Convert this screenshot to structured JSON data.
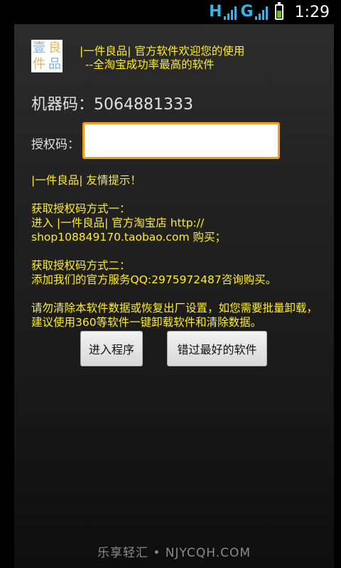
{
  "status_bar": {
    "network1": "H",
    "network2": "G",
    "time": "1:29",
    "colors": {
      "signal": "#33b5e5",
      "battery_fill": "#66bb22"
    }
  },
  "app": {
    "logo": {
      "chars": [
        "壹",
        "良",
        "件",
        "品"
      ]
    },
    "header_line1": "|一件良品|  官方软件欢迎您的使用",
    "header_line2": "--全淘宝成功率最高的软件",
    "machine_code_label": "机器码：",
    "machine_code_value": "5064881333",
    "auth_label": "授权码：",
    "auth_input_value": "",
    "tips": {
      "title": "|一件良品|  友情提示！",
      "method1_title": "获取授权码方式一：",
      "method1_line1": "进入 |一件良品|  官方淘宝店   http://",
      "method1_line2": "shop108849170.taobao.com  购买；",
      "method2_title": "获取授权码方式二：",
      "method2_line1": "添加我们的官方服务QQ:2975972487咨询购买。",
      "note": "请勿清除本软件数据或恢复出厂设置，如您需要批量卸载，建议使用360等软件一键卸载软件和清除数据。"
    },
    "buttons": {
      "enter": "进入程序",
      "miss": "错过最好的软件"
    },
    "colors": {
      "accent_text": "#ffee22",
      "input_border": "#f39a1c"
    }
  },
  "watermark": "乐享轻汇 • NJYCQH.COM"
}
